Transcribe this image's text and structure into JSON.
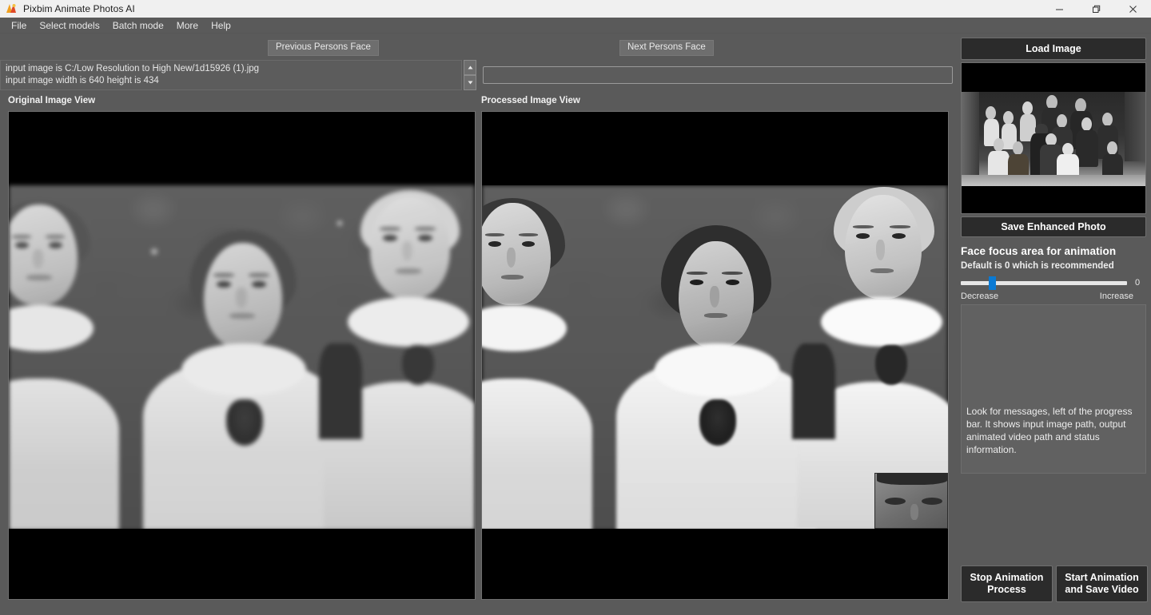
{
  "window": {
    "title": "Pixbim Animate Photos AI",
    "icon": "pixbim-logo-icon",
    "controls": {
      "minimize": "minimize-icon",
      "maximize": "restore-icon",
      "close": "close-icon"
    }
  },
  "menubar": {
    "items": [
      {
        "label": "File"
      },
      {
        "label": "Select models"
      },
      {
        "label": "Batch mode"
      },
      {
        "label": "More"
      },
      {
        "label": "Help"
      }
    ]
  },
  "toolbar": {
    "previous_face_label": "Previous Persons Face",
    "next_face_label": "Next Persons Face"
  },
  "log": {
    "lines": [
      "input image is C:/Low Resolution to High New/1d15926 (1).jpg",
      "input image width is 640 height is 434"
    ],
    "line1": "input image is C:/Low Resolution to High New/1d15926 (1).jpg",
    "line2": "input image width is 640 height is 434"
  },
  "path_input": {
    "value": "",
    "placeholder": ""
  },
  "views": {
    "original_label": "Original Image View",
    "processed_label": "Processed Image View"
  },
  "sidebar": {
    "load_image_label": "Load Image",
    "save_enhanced_label": "Save Enhanced Photo",
    "section_title": "Face focus area for animation",
    "section_subtitle": "Default is 0 which is recommended",
    "slider": {
      "value": "0",
      "min_label": "Decrease",
      "max_label": "Increase",
      "position_percent": 17,
      "accent_color": "#0a7ad4"
    },
    "message": "Look for messages, left of the progress bar. It shows input image path, output animated video path and status information.",
    "stop_button_line1": "Stop Animation",
    "stop_button_line2": "Process",
    "start_button_line1": "Start Animation",
    "start_button_line2": "and Save Video"
  },
  "colors": {
    "titlebar_bg": "#f0f0f0",
    "chrome_bg": "#5a5a5a",
    "button_dark": "#2b2b2b",
    "text_light": "#ededed",
    "accent": "#0a7ad4"
  }
}
